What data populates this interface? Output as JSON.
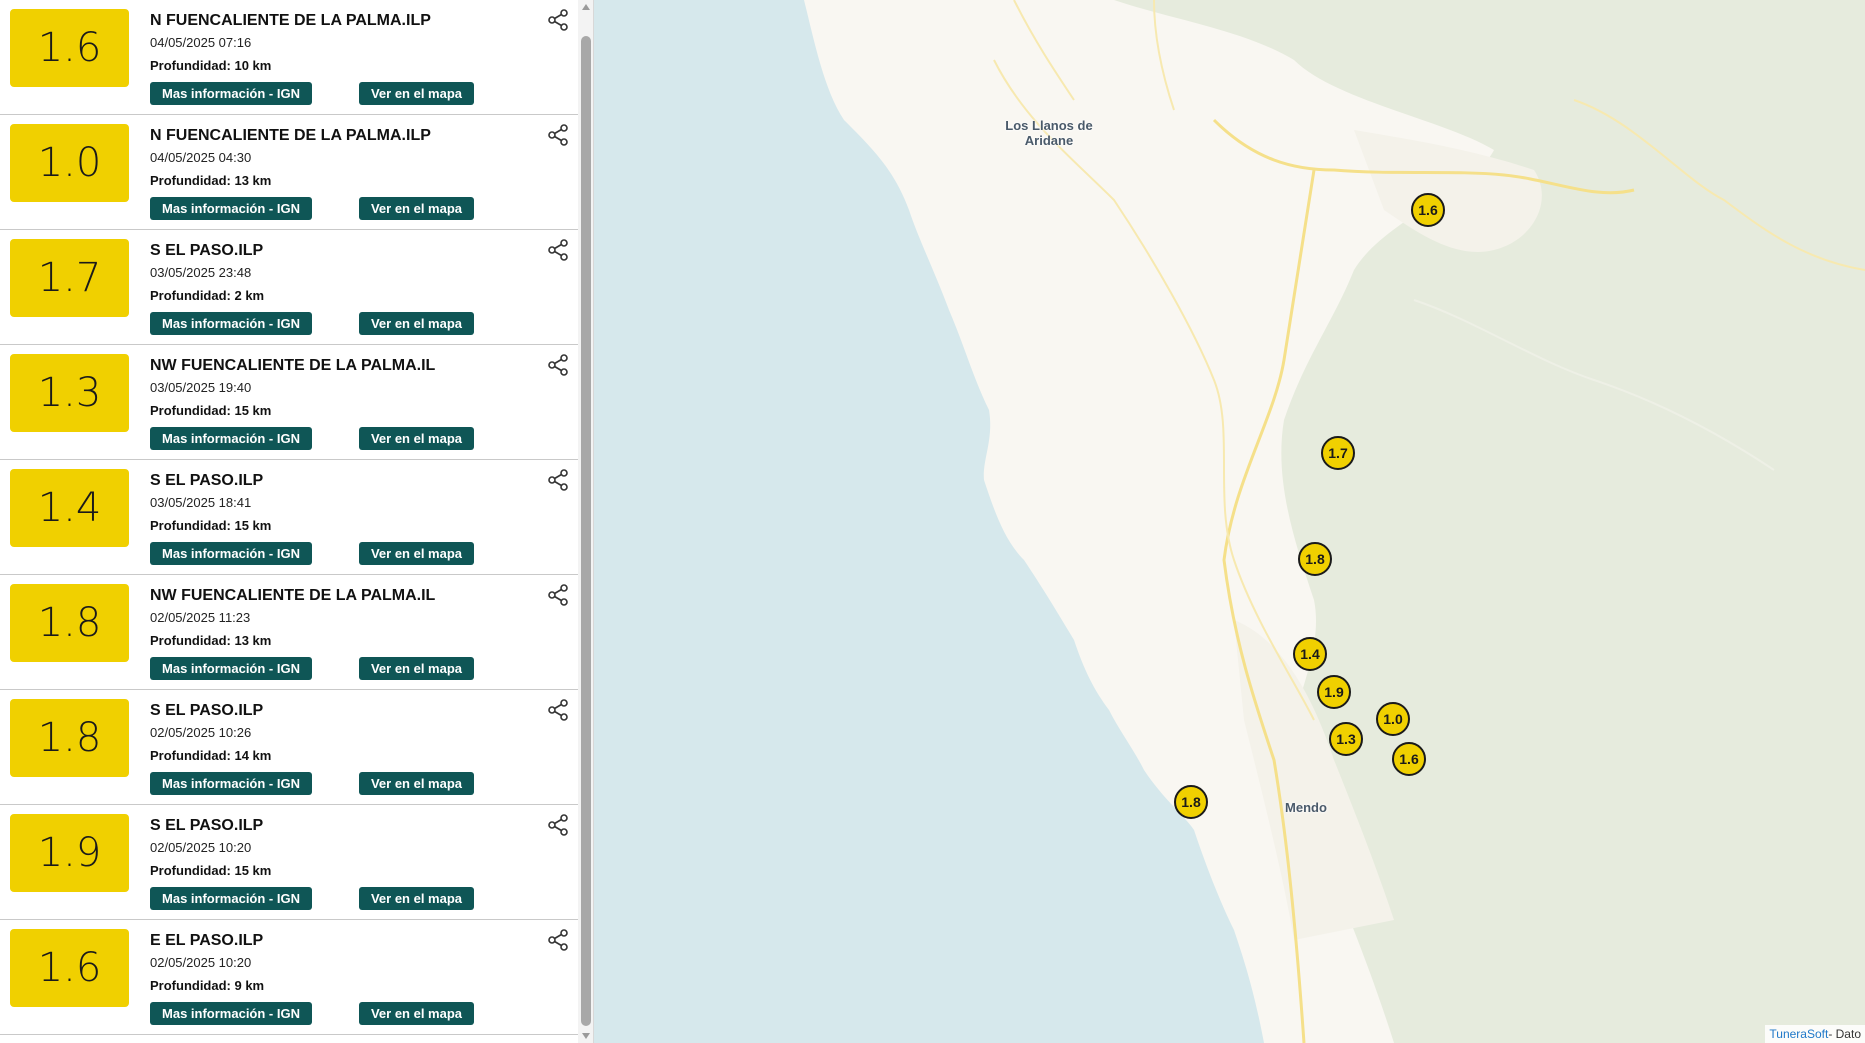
{
  "colors": {
    "magnitude_yellow": "#f0d000",
    "button_teal": "#0f5656",
    "sea": "#d6e8ec",
    "land_green": "#e6ebdd",
    "land_light": "#f9f7f2",
    "road_yellow": "#f7e7a0"
  },
  "buttons": {
    "info_label": "Mas información - IGN",
    "map_label": "Ver en el mapa"
  },
  "icons": {
    "share": "share-icon"
  },
  "earthquakes": [
    {
      "magnitude": "1.6",
      "place": "N FUENCALIENTE DE LA PALMA.ILP",
      "datetime": "04/05/2025 07:16",
      "depth": "Profundidad: 10 km"
    },
    {
      "magnitude": "1.0",
      "place": "N FUENCALIENTE DE LA PALMA.ILP",
      "datetime": "04/05/2025 04:30",
      "depth": "Profundidad: 13 km"
    },
    {
      "magnitude": "1.7",
      "place": "S EL PASO.ILP",
      "datetime": "03/05/2025 23:48",
      "depth": "Profundidad: 2 km"
    },
    {
      "magnitude": "1.3",
      "place": "NW FUENCALIENTE DE LA PALMA.IL",
      "datetime": "03/05/2025 19:40",
      "depth": "Profundidad: 15 km"
    },
    {
      "magnitude": "1.4",
      "place": "S EL PASO.ILP",
      "datetime": "03/05/2025 18:41",
      "depth": "Profundidad: 15 km"
    },
    {
      "magnitude": "1.8",
      "place": "NW FUENCALIENTE DE LA PALMA.IL",
      "datetime": "02/05/2025 11:23",
      "depth": "Profundidad: 13 km"
    },
    {
      "magnitude": "1.8",
      "place": "S EL PASO.ILP",
      "datetime": "02/05/2025 10:26",
      "depth": "Profundidad: 14 km"
    },
    {
      "magnitude": "1.9",
      "place": "S EL PASO.ILP",
      "datetime": "02/05/2025 10:20",
      "depth": "Profundidad: 15 km"
    },
    {
      "magnitude": "1.6",
      "place": "E EL PASO.ILP",
      "datetime": "02/05/2025 10:20",
      "depth": "Profundidad: 9 km"
    }
  ],
  "map": {
    "place_labels": [
      {
        "text": "Los Llanos de\nAridane"
      },
      {
        "text": "Mendo"
      }
    ],
    "markers": [
      {
        "magnitude": "1.6"
      },
      {
        "magnitude": "1.7"
      },
      {
        "magnitude": "1.8"
      },
      {
        "magnitude": "1.4"
      },
      {
        "magnitude": "1.9"
      },
      {
        "magnitude": "1.0"
      },
      {
        "magnitude": "1.3"
      },
      {
        "magnitude": "1.6"
      },
      {
        "magnitude": "1.8"
      }
    ],
    "attribution_link": "TuneraSoft",
    "attribution_text": " - Dato"
  }
}
